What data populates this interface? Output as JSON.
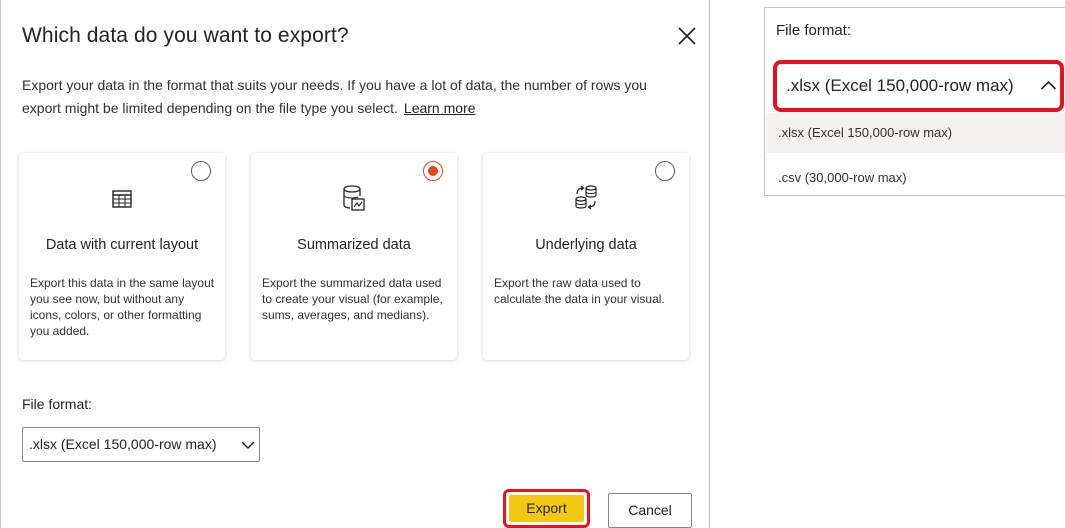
{
  "dialog": {
    "title": "Which data do you want to export?",
    "description": "Export your data in the format that suits your needs. If you have a lot of data, the number of rows you export might be limited depending on the file type you select.",
    "learn_more": "Learn more",
    "cards": [
      {
        "title": "Data with current layout",
        "description": "Export this data in the same layout you see now, but without any icons, colors, or other formatting you added.",
        "icon": "table-grid-icon",
        "selected": false
      },
      {
        "title": "Summarized data",
        "description": "Export the summarized data used to create your visual (for example, sums, averages, and medians).",
        "icon": "database-chart-icon",
        "selected": true
      },
      {
        "title": "Underlying data",
        "description": "Export the raw data used to calculate the data in your visual.",
        "icon": "database-sync-icon",
        "selected": false
      }
    ],
    "file_format_label": "File format:",
    "file_format_value": ".xlsx (Excel 150,000-row max)",
    "export_label": "Export",
    "cancel_label": "Cancel"
  },
  "zoom": {
    "label": "File format:",
    "selected": ".xlsx (Excel 150,000-row max)",
    "options": [
      ".xlsx (Excel 150,000-row max)",
      ".csv (30,000-row max)"
    ]
  },
  "colors": {
    "accent_radio": "#e0471a",
    "export_button": "#f2c811",
    "highlight_border": "#e81123"
  }
}
